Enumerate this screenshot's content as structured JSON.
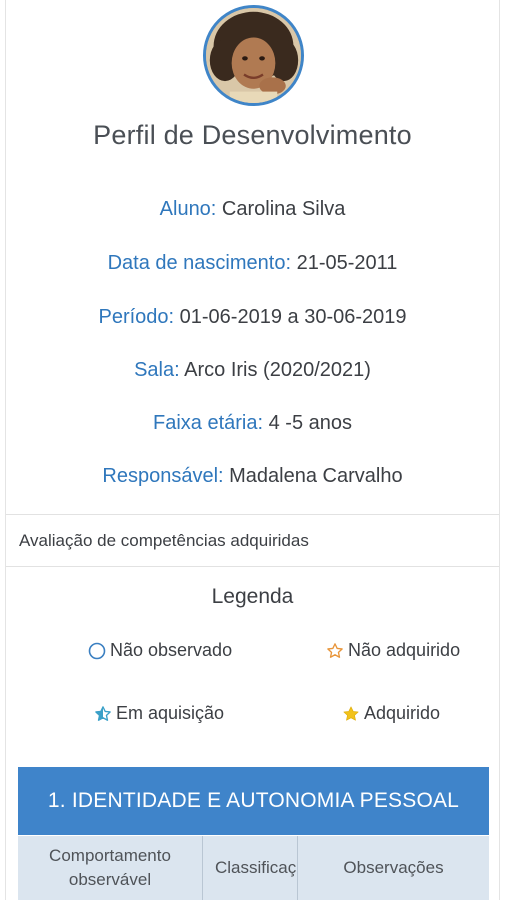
{
  "profile": {
    "title": "Perfil de Desenvolvimento",
    "fields": [
      {
        "label": "Aluno:",
        "value": " Carolina Silva"
      },
      {
        "label": "Data de nascimento:",
        "value": " 21-05-2011"
      },
      {
        "label": "Período:",
        "value": " 01-06-2019 a 30-06-2019"
      },
      {
        "label": "Sala:",
        "value": " Arco Iris (2020/2021)"
      },
      {
        "label": "Faixa etária:",
        "value": " 4 -5 anos"
      },
      {
        "label": "Responsável:",
        "value": " Madalena Carvalho"
      }
    ]
  },
  "assessment": {
    "section_label": "Avaliação de competências adquiridas",
    "legend": {
      "title": "Legenda",
      "items": [
        {
          "icon": "circle-outline-icon",
          "label": "Não observado",
          "color": "#3a7fc1"
        },
        {
          "icon": "star-outline-icon",
          "label": "Não adquirido",
          "color": "#e8953a"
        },
        {
          "icon": "star-half-icon",
          "label": "Em aquisição",
          "color": "#3aa0c8"
        },
        {
          "icon": "star-filled-icon",
          "label": "Adquirido",
          "color": "#f2c21a"
        }
      ]
    },
    "section_heading": "1. IDENTIDADE E AUTONOMIA PESSOAL",
    "table_headers": [
      "Comportamento observável",
      "Classificaç",
      "Observações"
    ]
  },
  "colors": {
    "accent": "#3f84ca",
    "label_blue": "#2f77bc",
    "table_header_bg": "#dbe5ef"
  }
}
